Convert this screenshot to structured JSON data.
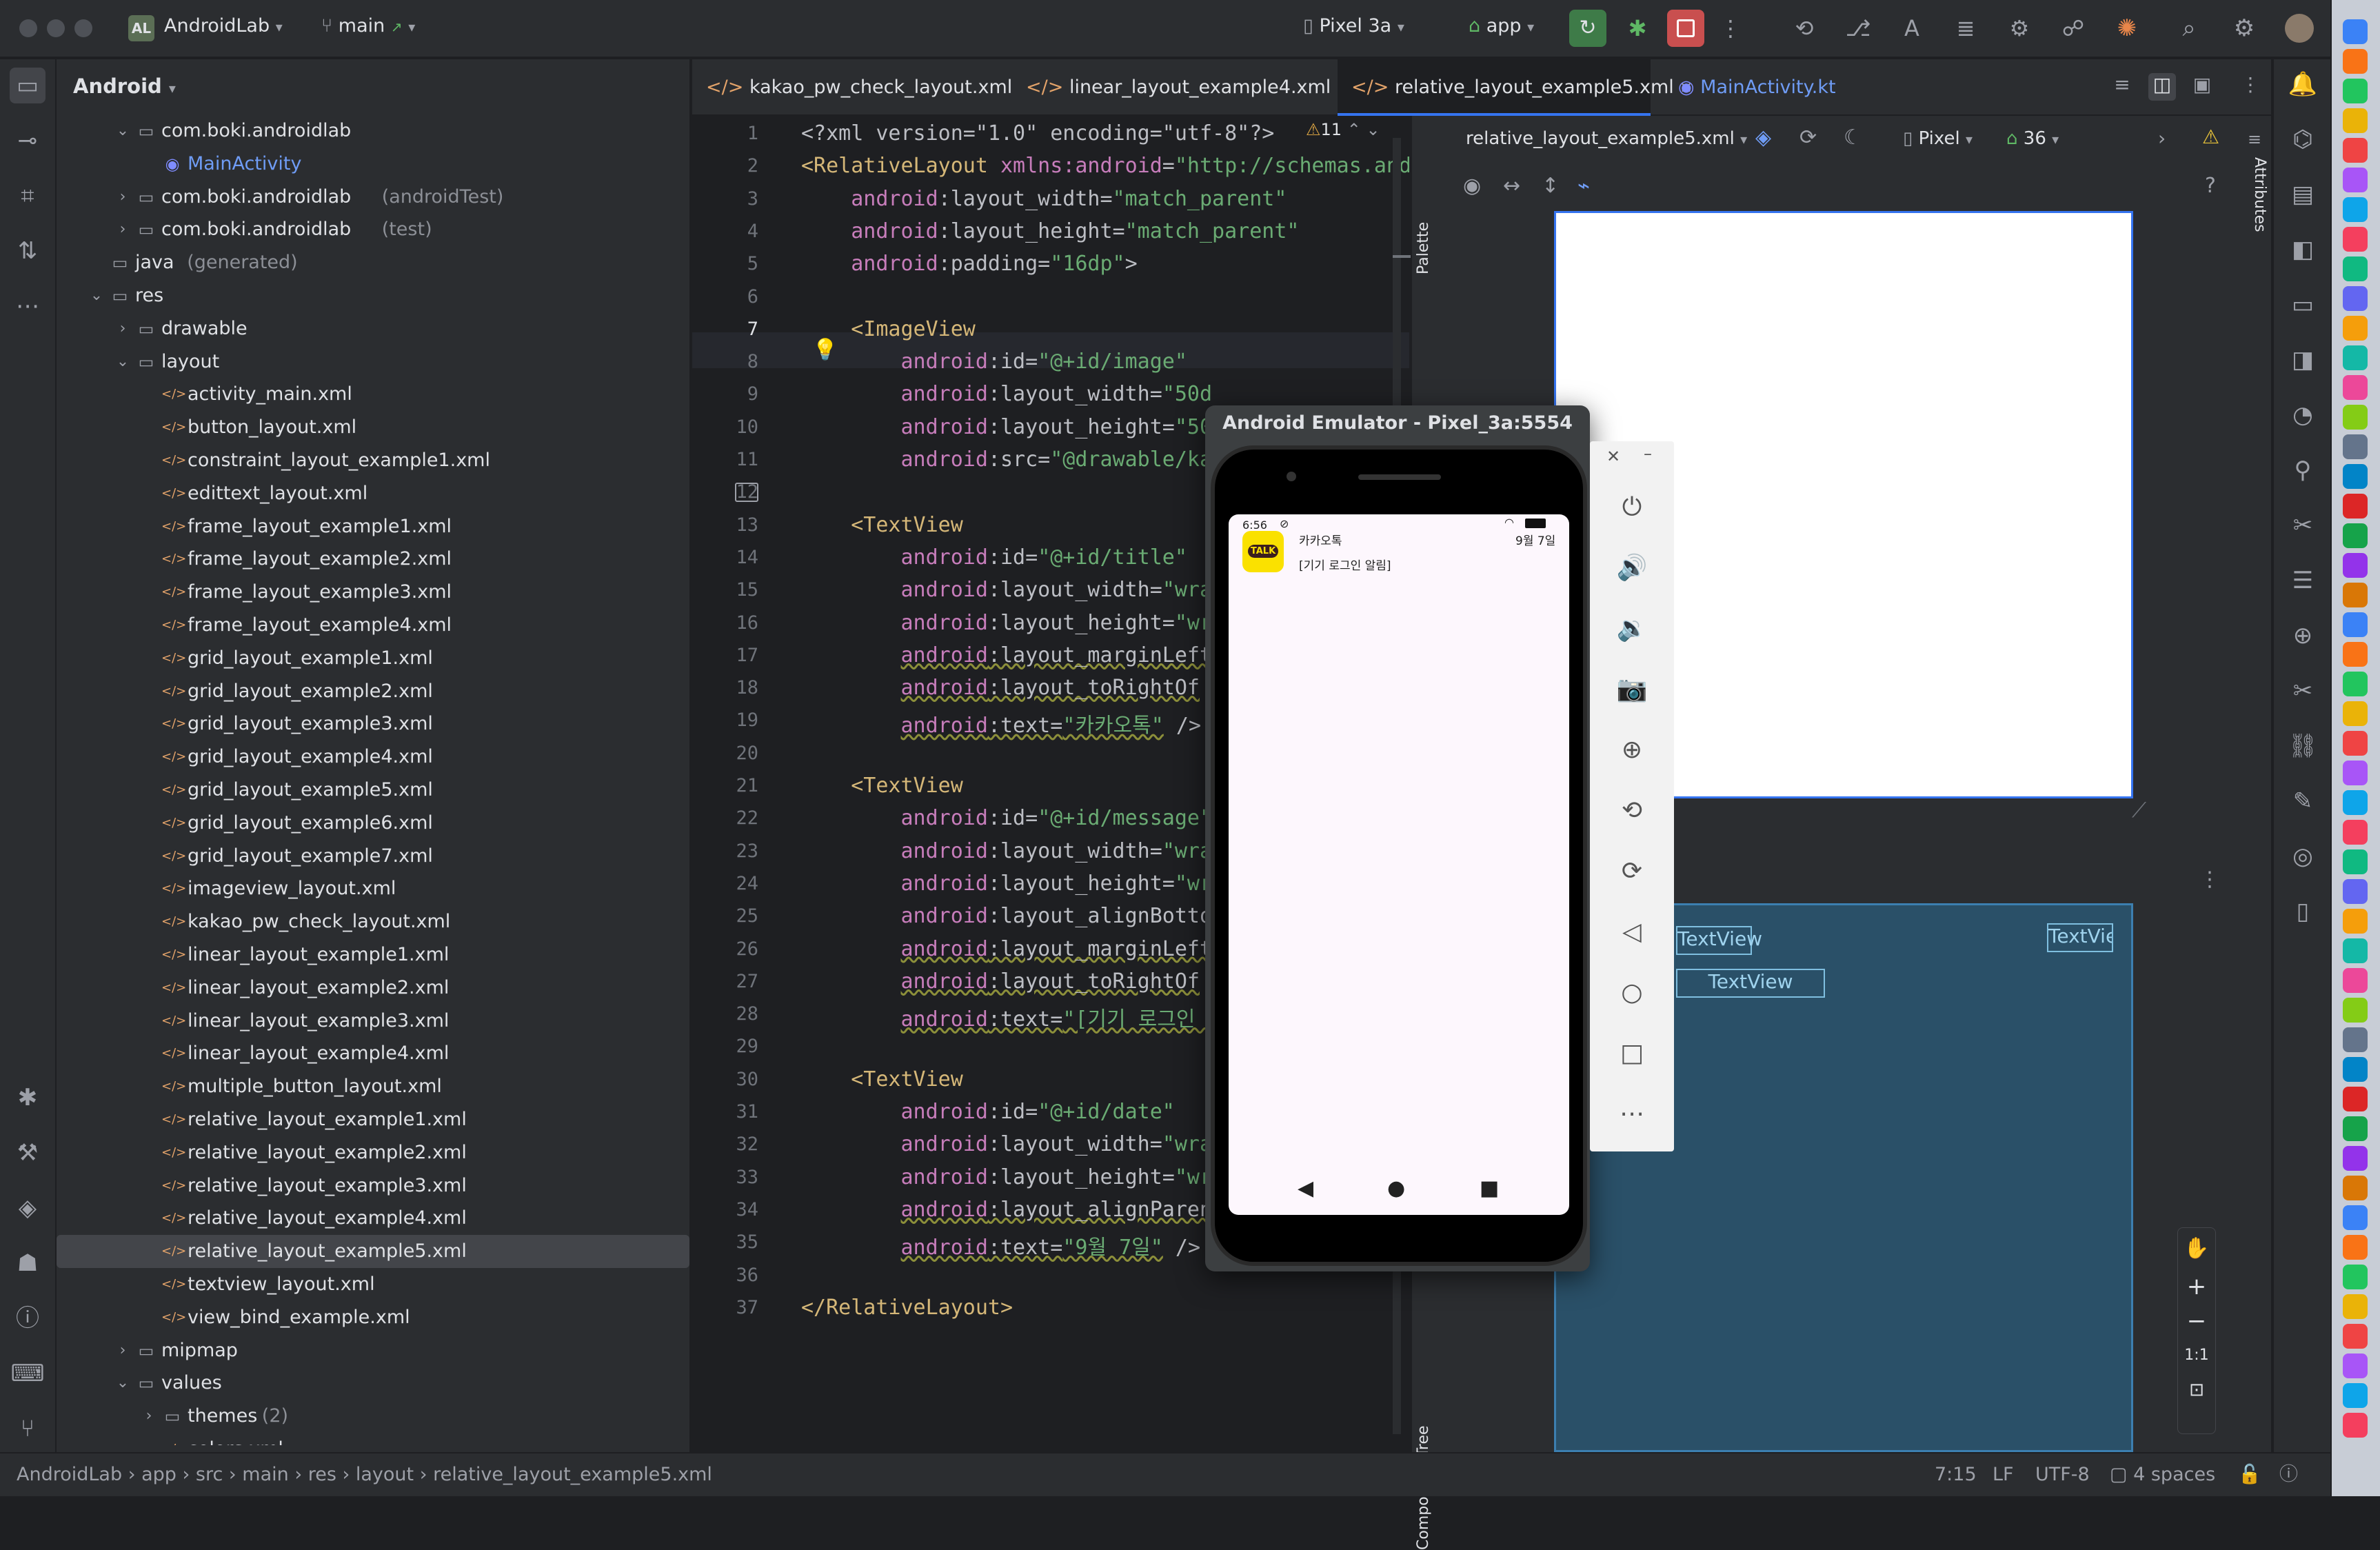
{
  "titlebar": {
    "project_badge": "AL",
    "project_name": "AndroidLab",
    "branch": "main",
    "device": "Pixel 3a",
    "run_config": "app"
  },
  "project_panel": {
    "view_mode": "Android",
    "tree": [
      {
        "label": "com.boki.androidlab",
        "suffix": "",
        "kind": "package",
        "depth": 2,
        "caret": "v"
      },
      {
        "label": "MainActivity",
        "suffix": "",
        "kind": "kotlin",
        "depth": 3,
        "caret": ""
      },
      {
        "label": "com.boki.androidlab",
        "suffix": "(androidTest)",
        "kind": "package",
        "depth": 2,
        "caret": ">"
      },
      {
        "label": "com.boki.androidlab",
        "suffix": "(test)",
        "kind": "package",
        "depth": 2,
        "caret": ">"
      },
      {
        "label": "java",
        "suffix": "(generated)",
        "kind": "folder",
        "depth": 1,
        "caret": ""
      },
      {
        "label": "res",
        "suffix": "",
        "kind": "folder",
        "depth": 1,
        "caret": "v"
      },
      {
        "label": "drawable",
        "suffix": "",
        "kind": "folder",
        "depth": 2,
        "caret": ">"
      },
      {
        "label": "layout",
        "suffix": "",
        "kind": "folder",
        "depth": 2,
        "caret": "v"
      },
      {
        "label": "activity_main.xml",
        "suffix": "",
        "kind": "xml",
        "depth": 3,
        "caret": ""
      },
      {
        "label": "button_layout.xml",
        "suffix": "",
        "kind": "xml",
        "depth": 3,
        "caret": ""
      },
      {
        "label": "constraint_layout_example1.xml",
        "suffix": "",
        "kind": "xml",
        "depth": 3,
        "caret": ""
      },
      {
        "label": "edittext_layout.xml",
        "suffix": "",
        "kind": "xml",
        "depth": 3,
        "caret": ""
      },
      {
        "label": "frame_layout_example1.xml",
        "suffix": "",
        "kind": "xml",
        "depth": 3,
        "caret": ""
      },
      {
        "label": "frame_layout_example2.xml",
        "suffix": "",
        "kind": "xml",
        "depth": 3,
        "caret": ""
      },
      {
        "label": "frame_layout_example3.xml",
        "suffix": "",
        "kind": "xml",
        "depth": 3,
        "caret": ""
      },
      {
        "label": "frame_layout_example4.xml",
        "suffix": "",
        "kind": "xml",
        "depth": 3,
        "caret": ""
      },
      {
        "label": "grid_layout_example1.xml",
        "suffix": "",
        "kind": "xml",
        "depth": 3,
        "caret": ""
      },
      {
        "label": "grid_layout_example2.xml",
        "suffix": "",
        "kind": "xml",
        "depth": 3,
        "caret": ""
      },
      {
        "label": "grid_layout_example3.xml",
        "suffix": "",
        "kind": "xml",
        "depth": 3,
        "caret": ""
      },
      {
        "label": "grid_layout_example4.xml",
        "suffix": "",
        "kind": "xml",
        "depth": 3,
        "caret": ""
      },
      {
        "label": "grid_layout_example5.xml",
        "suffix": "",
        "kind": "xml",
        "depth": 3,
        "caret": ""
      },
      {
        "label": "grid_layout_example6.xml",
        "suffix": "",
        "kind": "xml",
        "depth": 3,
        "caret": ""
      },
      {
        "label": "grid_layout_example7.xml",
        "suffix": "",
        "kind": "xml",
        "depth": 3,
        "caret": ""
      },
      {
        "label": "imageview_layout.xml",
        "suffix": "",
        "kind": "xml",
        "depth": 3,
        "caret": ""
      },
      {
        "label": "kakao_pw_check_layout.xml",
        "suffix": "",
        "kind": "xml",
        "depth": 3,
        "caret": ""
      },
      {
        "label": "linear_layout_example1.xml",
        "suffix": "",
        "kind": "xml",
        "depth": 3,
        "caret": ""
      },
      {
        "label": "linear_layout_example2.xml",
        "suffix": "",
        "kind": "xml",
        "depth": 3,
        "caret": ""
      },
      {
        "label": "linear_layout_example3.xml",
        "suffix": "",
        "kind": "xml",
        "depth": 3,
        "caret": ""
      },
      {
        "label": "linear_layout_example4.xml",
        "suffix": "",
        "kind": "xml",
        "depth": 3,
        "caret": ""
      },
      {
        "label": "multiple_button_layout.xml",
        "suffix": "",
        "kind": "xml",
        "depth": 3,
        "caret": ""
      },
      {
        "label": "relative_layout_example1.xml",
        "suffix": "",
        "kind": "xml",
        "depth": 3,
        "caret": ""
      },
      {
        "label": "relative_layout_example2.xml",
        "suffix": "",
        "kind": "xml",
        "depth": 3,
        "caret": ""
      },
      {
        "label": "relative_layout_example3.xml",
        "suffix": "",
        "kind": "xml",
        "depth": 3,
        "caret": ""
      },
      {
        "label": "relative_layout_example4.xml",
        "suffix": "",
        "kind": "xml",
        "depth": 3,
        "caret": ""
      },
      {
        "label": "relative_layout_example5.xml",
        "suffix": "",
        "kind": "xml",
        "depth": 3,
        "caret": "",
        "selected": true
      },
      {
        "label": "textview_layout.xml",
        "suffix": "",
        "kind": "xml",
        "depth": 3,
        "caret": ""
      },
      {
        "label": "view_bind_example.xml",
        "suffix": "",
        "kind": "xml",
        "depth": 3,
        "caret": ""
      },
      {
        "label": "mipmap",
        "suffix": "",
        "kind": "folder",
        "depth": 2,
        "caret": ">"
      },
      {
        "label": "values",
        "suffix": "",
        "kind": "folder",
        "depth": 2,
        "caret": "v"
      },
      {
        "label": "themes",
        "suffix": "(2)",
        "kind": "folder",
        "depth": 3,
        "caret": ">"
      },
      {
        "label": "colors.xml",
        "suffix": "",
        "kind": "xml",
        "depth": 3,
        "caret": ""
      }
    ]
  },
  "editor_tabs": [
    {
      "label": "kakao_pw_check_layout.xml",
      "active": false,
      "kind": "xml"
    },
    {
      "label": "linear_layout_example4.xml",
      "active": false,
      "kind": "xml"
    },
    {
      "label": "relative_layout_example5.xml",
      "active": true,
      "kind": "xml"
    },
    {
      "label": "MainActivity.kt",
      "active": false,
      "kind": "kotlin"
    }
  ],
  "editor": {
    "warning_count": "11",
    "lines": [
      {
        "n": "1",
        "parts": [
          [
            "pun",
            "<?xml version=\"1.0\" encoding=\"utf-8\"?>"
          ]
        ]
      },
      {
        "n": "2",
        "parts": [
          [
            "tag",
            "<RelativeLayout "
          ],
          [
            "ns",
            "xmlns:android"
          ],
          [
            "pun",
            "="
          ],
          [
            "val",
            "\"http://schemas.and"
          ]
        ]
      },
      {
        "n": "3",
        "parts": [
          [
            "ind",
            "    "
          ],
          [
            "ns",
            "android"
          ],
          [
            "at",
            ":layout_width="
          ],
          [
            "val",
            "\"match_parent\""
          ]
        ]
      },
      {
        "n": "4",
        "parts": [
          [
            "ind",
            "    "
          ],
          [
            "ns",
            "android"
          ],
          [
            "at",
            ":layout_height="
          ],
          [
            "val",
            "\"match_parent\""
          ]
        ]
      },
      {
        "n": "5",
        "parts": [
          [
            "ind",
            "    "
          ],
          [
            "ns",
            "android"
          ],
          [
            "at",
            ":padding="
          ],
          [
            "val",
            "\"16dp\""
          ],
          [
            "pun",
            ">"
          ]
        ]
      },
      {
        "n": "6",
        "parts": []
      },
      {
        "n": "7",
        "parts": [
          [
            "ind",
            "    "
          ],
          [
            "tag",
            "<ImageView"
          ]
        ]
      },
      {
        "n": "8",
        "parts": [
          [
            "ind",
            "        "
          ],
          [
            "ns",
            "android"
          ],
          [
            "at",
            ":id="
          ],
          [
            "val",
            "\"@+id/image\""
          ]
        ]
      },
      {
        "n": "9",
        "parts": [
          [
            "ind",
            "        "
          ],
          [
            "ns",
            "android"
          ],
          [
            "at",
            ":layout_width="
          ],
          [
            "val",
            "\"50d"
          ]
        ]
      },
      {
        "n": "10",
        "parts": [
          [
            "ind",
            "        "
          ],
          [
            "ns",
            "android"
          ],
          [
            "at",
            ":layout_height="
          ],
          [
            "val",
            "\"50"
          ]
        ]
      },
      {
        "n": "11",
        "parts": [
          [
            "ind",
            "        "
          ],
          [
            "ns",
            "android"
          ],
          [
            "at",
            ":src="
          ],
          [
            "val",
            "\"@drawable/ka"
          ]
        ]
      },
      {
        "n": "12",
        "parts": []
      },
      {
        "n": "13",
        "parts": [
          [
            "ind",
            "    "
          ],
          [
            "tag",
            "<TextView"
          ]
        ]
      },
      {
        "n": "14",
        "parts": [
          [
            "ind",
            "        "
          ],
          [
            "ns",
            "android"
          ],
          [
            "at",
            ":id="
          ],
          [
            "val",
            "\"@+id/title\""
          ]
        ]
      },
      {
        "n": "15",
        "parts": [
          [
            "ind",
            "        "
          ],
          [
            "ns",
            "android"
          ],
          [
            "at",
            ":layout_width="
          ],
          [
            "val",
            "\"wra"
          ]
        ]
      },
      {
        "n": "16",
        "parts": [
          [
            "ind",
            "        "
          ],
          [
            "ns",
            "android"
          ],
          [
            "at",
            ":layout_height="
          ],
          [
            "val",
            "\"wr"
          ]
        ]
      },
      {
        "n": "17",
        "parts": [
          [
            "ind",
            "        "
          ],
          [
            "nsu",
            "android"
          ],
          [
            "atu",
            ":layout_marginLeft"
          ]
        ]
      },
      {
        "n": "18",
        "parts": [
          [
            "ind",
            "        "
          ],
          [
            "nsu",
            "android"
          ],
          [
            "atu",
            ":layout_toRightOf"
          ]
        ]
      },
      {
        "n": "19",
        "parts": [
          [
            "ind",
            "        "
          ],
          [
            "nsu",
            "android"
          ],
          [
            "atu",
            ":text="
          ],
          [
            "valu",
            "\"카카오톡\""
          ],
          [
            "pun",
            " />"
          ]
        ]
      },
      {
        "n": "20",
        "parts": []
      },
      {
        "n": "21",
        "parts": [
          [
            "ind",
            "    "
          ],
          [
            "tag",
            "<TextView"
          ]
        ]
      },
      {
        "n": "22",
        "parts": [
          [
            "ind",
            "        "
          ],
          [
            "ns",
            "android"
          ],
          [
            "at",
            ":id="
          ],
          [
            "val",
            "\"@+id/message\""
          ]
        ]
      },
      {
        "n": "23",
        "parts": [
          [
            "ind",
            "        "
          ],
          [
            "ns",
            "android"
          ],
          [
            "at",
            ":layout_width="
          ],
          [
            "val",
            "\"wra"
          ]
        ]
      },
      {
        "n": "24",
        "parts": [
          [
            "ind",
            "        "
          ],
          [
            "ns",
            "android"
          ],
          [
            "at",
            ":layout_height="
          ],
          [
            "val",
            "\"wr"
          ]
        ]
      },
      {
        "n": "25",
        "parts": [
          [
            "ind",
            "        "
          ],
          [
            "ns",
            "android"
          ],
          [
            "at",
            ":layout_alignBotto"
          ]
        ]
      },
      {
        "n": "26",
        "parts": [
          [
            "ind",
            "        "
          ],
          [
            "nsu",
            "android"
          ],
          [
            "atu",
            ":layout_marginLeft"
          ]
        ]
      },
      {
        "n": "27",
        "parts": [
          [
            "ind",
            "        "
          ],
          [
            "nsu",
            "android"
          ],
          [
            "atu",
            ":layout_toRightOf"
          ]
        ]
      },
      {
        "n": "28",
        "parts": [
          [
            "ind",
            "        "
          ],
          [
            "nsu",
            "android"
          ],
          [
            "atu",
            ":text="
          ],
          [
            "valu",
            "\"[기기 로그인 "
          ]
        ]
      },
      {
        "n": "29",
        "parts": []
      },
      {
        "n": "30",
        "parts": [
          [
            "ind",
            "    "
          ],
          [
            "tag",
            "<TextView"
          ]
        ]
      },
      {
        "n": "31",
        "parts": [
          [
            "ind",
            "        "
          ],
          [
            "ns",
            "android"
          ],
          [
            "at",
            ":id="
          ],
          [
            "val",
            "\"@+id/date\""
          ]
        ]
      },
      {
        "n": "32",
        "parts": [
          [
            "ind",
            "        "
          ],
          [
            "ns",
            "android"
          ],
          [
            "at",
            ":layout_width="
          ],
          [
            "val",
            "\"wra"
          ]
        ]
      },
      {
        "n": "33",
        "parts": [
          [
            "ind",
            "        "
          ],
          [
            "ns",
            "android"
          ],
          [
            "at",
            ":layout_height="
          ],
          [
            "val",
            "\"wrap_content\""
          ]
        ]
      },
      {
        "n": "34",
        "parts": [
          [
            "ind",
            "        "
          ],
          [
            "nsu",
            "android"
          ],
          [
            "atu",
            ":layout_alignParentRight="
          ],
          [
            "val",
            "\"true\""
          ]
        ]
      },
      {
        "n": "35",
        "parts": [
          [
            "ind",
            "        "
          ],
          [
            "nsu",
            "android"
          ],
          [
            "atu",
            ":text="
          ],
          [
            "valu",
            "\"9월 7일\""
          ],
          [
            "pun",
            " />"
          ]
        ]
      },
      {
        "n": "36",
        "parts": []
      },
      {
        "n": "37",
        "parts": [
          [
            "tag",
            "</RelativeLayout>"
          ]
        ]
      }
    ]
  },
  "design": {
    "file": "relative_layout_example5.xml",
    "device": "Pixel",
    "api": "36",
    "palette_label": "Palette",
    "component_tree_label": "Component Tree",
    "attributes_label": "Attributes",
    "blueprint_labels": [
      "TextView",
      "TextView",
      "TextVie"
    ],
    "zoom_ratio": "1:1"
  },
  "emulator": {
    "title": "Android Emulator - Pixel_3a:5554",
    "status_time": "6:56",
    "app_icon_text": "TALK",
    "title_text": "카카오톡",
    "message_text": "[기기 로그인 알림]",
    "date_text": "9월 7일"
  },
  "statusbar": {
    "breadcrumb": [
      "AndroidLab",
      "app",
      "src",
      "main",
      "res",
      "layout",
      "relative_layout_example5.xml"
    ],
    "position": "7:15",
    "line_sep": "LF",
    "encoding": "UTF-8",
    "indent": "4 spaces"
  },
  "colors": {
    "accent": "#3574f0",
    "kakao_yellow": "#fae100",
    "blueprint_bg": "#2a5068"
  }
}
